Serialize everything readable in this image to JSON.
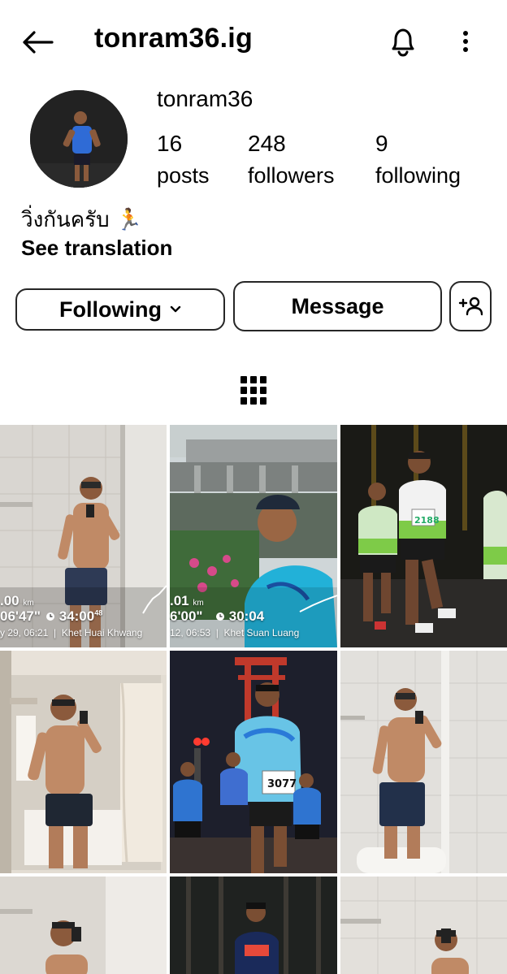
{
  "header": {
    "title": "tonram36.ig"
  },
  "profile": {
    "username": "tonram36",
    "stats": [
      {
        "value": "16",
        "label": "posts"
      },
      {
        "value": "248",
        "label": "followers"
      },
      {
        "value": "9",
        "label": "following"
      }
    ],
    "bio": "วิ่งกันครับ",
    "bio_emoji": "🏃",
    "see_translation": "See translation"
  },
  "actions": {
    "following": "Following",
    "message": "Message"
  },
  "posts": [
    {
      "distance": ".00",
      "distance_unit": "km",
      "pace": "06'47\"",
      "duration": "34:00",
      "duration_fraction": "48",
      "datetime": "y 29, 06:21",
      "location": "Khet Huai Khwang"
    },
    {
      "distance": ".01",
      "distance_unit": "km",
      "pace": "6'00\"",
      "duration": "30:04",
      "duration_fraction": "",
      "datetime": "12, 06:53",
      "location": "Khet Suan Luang"
    },
    {
      "bib_number": "2188"
    },
    {},
    {
      "bib_number": "3077"
    },
    {},
    {},
    {},
    {}
  ],
  "icons": {
    "back": "arrow-left-icon",
    "bell": "bell-icon",
    "more": "more-vertical-icon",
    "chevron": "chevron-down-icon",
    "add_user": "add-user-icon",
    "grid": "grid-icon",
    "pace": "clock-icon"
  }
}
